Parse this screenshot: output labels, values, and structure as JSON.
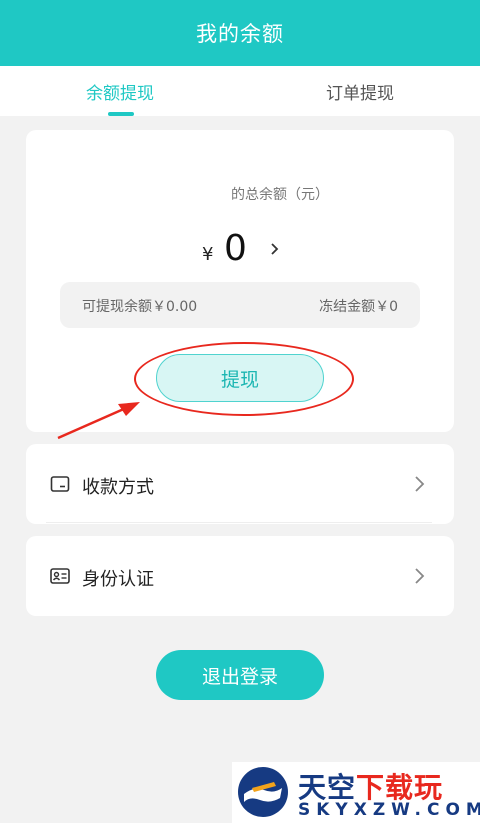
{
  "header": {
    "title": "我的余额"
  },
  "tabs": [
    {
      "label": "余额提现",
      "active": true
    },
    {
      "label": "订单提现",
      "active": false
    }
  ],
  "balance": {
    "caption": "的总余额（元）",
    "currency": "¥",
    "amount": "0",
    "withdrawable": "可提现余额￥0.00",
    "frozen": "冻结金额￥0"
  },
  "withdraw_button": "提现",
  "menu": [
    {
      "label": "收款方式",
      "icon": "card-icon"
    },
    {
      "label": "身份认证",
      "icon": "id-card-icon"
    }
  ],
  "logout_button": "退出登录",
  "watermark": {
    "top_text_a": "天空",
    "top_text_b": "下载玩",
    "bottom_text": "SKYXZW.COM"
  },
  "colors": {
    "accent": "#1fc8c4",
    "annotation_red": "#e8281e",
    "background": "#f2f2f2"
  }
}
